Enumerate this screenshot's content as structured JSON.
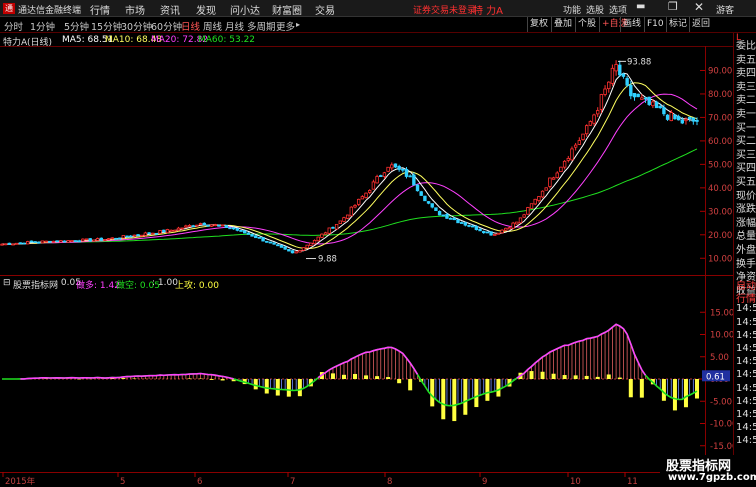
{
  "menubar": {
    "app_name": "通达信金融终端",
    "logo": "通",
    "menus": [
      "行情",
      "市场",
      "资讯",
      "发现",
      "问小达",
      "财富圈",
      "交易"
    ],
    "notice": "证券交易未登录",
    "stock_title": "特 力A",
    "right_items": [
      "功能",
      "选股",
      "选项"
    ],
    "guest": "游客"
  },
  "periodbar": {
    "periods": [
      "分时",
      "1分钟",
      "5分钟",
      "15分钟",
      "30分钟",
      "60分钟",
      "日线",
      "周线",
      "月线",
      "多周期",
      "更多"
    ],
    "active": "日线",
    "tools": [
      "复权",
      "叠加",
      "个股",
      "画线",
      "F10",
      "标记",
      "返回"
    ],
    "self_select": "+自选"
  },
  "infobar": {
    "stock": "特力A",
    "period": "(日线)",
    "ma5": "MA5: 68.51",
    "ma10": "MA10: 68.48",
    "ma20": "MA20: 72.82",
    "ma60": "MA60: 53.22"
  },
  "side": {
    "top_badge": "L",
    "items": [
      "委比",
      "卖五",
      "卖四",
      "卖三",
      "卖二",
      "卖一",
      "买一",
      "买二",
      "买三",
      "买四",
      "买五",
      "现价",
      "涨跌",
      "涨幅",
      "总量",
      "外盘",
      "换手",
      "净资",
      "收益"
    ],
    "sub_items": [
      "自动",
      "行情",
      "14:50",
      "14:50",
      "14:50",
      "14:50",
      "14:50",
      "14:50",
      "14:50",
      "14:50",
      "14:50",
      "14:50",
      "14:50"
    ]
  },
  "main_chart": {
    "price_axis": [
      "90.00",
      "80.00",
      "70.00",
      "60.00",
      "50.00",
      "40.00",
      "30.00",
      "20.00",
      "10.00"
    ],
    "high_label": "93.88",
    "low_label": "9.88"
  },
  "subchart": {
    "name": "股票指标网",
    "v1": ": 0.05",
    "long_label": "做多: 1.42",
    "short_label": "做空: 0.05",
    "val": ": 1.00",
    "up_label": "上攻: 0.00",
    "axis": [
      "15.00",
      "10.00",
      "5.00",
      "0.00",
      "-5.00",
      "-10.00",
      "-15.00"
    ],
    "current_value": "0.61"
  },
  "dates": [
    "2015年",
    "5",
    "6",
    "7",
    "8",
    "9",
    "10",
    "11"
  ],
  "watermark": {
    "line1": "股票指标网",
    "line2": "www.7gpzb.com"
  },
  "colors": {
    "up": "#ff3030",
    "down": "#30d0ff",
    "ma5": "#ffffff",
    "ma10": "#ffff60",
    "ma20": "#ff40ff",
    "ma60": "#20e020",
    "yellow_bar": "#ffff40"
  }
}
